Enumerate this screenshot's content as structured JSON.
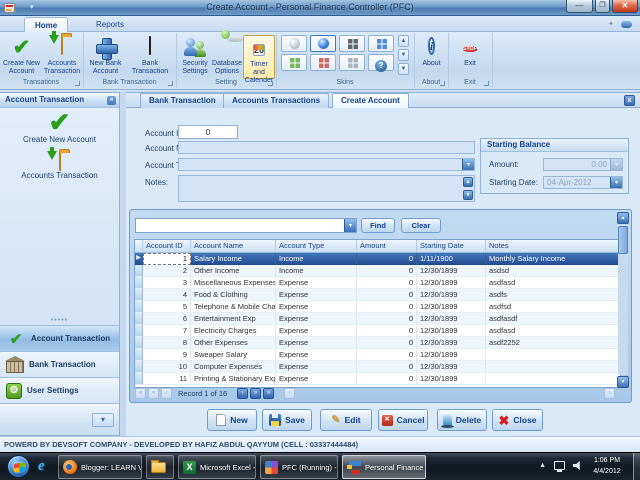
{
  "window": {
    "title": "Create Account - Personal Finance Controller (PFC)"
  },
  "colors": {
    "accent": "#15428b",
    "selection_blue": "#2b5da8",
    "titlebar_blue": "#5585bd",
    "ribbon_bg": "#d5e5f5",
    "taskbar_black": "#12161c",
    "success_green": "#2ca01c",
    "stop_red": "#d22b1f"
  },
  "ribbon": {
    "tabs": [
      {
        "label": "Home"
      },
      {
        "label": "Reports"
      }
    ],
    "active_tab": "Home",
    "groups": [
      {
        "caption": "Transations",
        "buttons": [
          {
            "label": "Create New Account",
            "icon": "green-check-icon"
          },
          {
            "label": "Accounts Transaction",
            "icon": "folder-download-icon"
          }
        ]
      },
      {
        "caption": "Bank Transaction",
        "buttons": [
          {
            "label": "New Bank Account",
            "icon": "blue-plus-icon"
          },
          {
            "label": "Bank Transaction",
            "icon": "ledger-icon"
          }
        ]
      },
      {
        "caption": "Setting",
        "buttons": [
          {
            "label": "Security Settings",
            "icon": "users-icon"
          },
          {
            "label": "Database Options",
            "icon": "database-icon"
          },
          {
            "label": "Timer and Calender",
            "icon": "calendar-icon",
            "selected": true,
            "calendar_day": "26"
          }
        ]
      },
      {
        "caption": "Skins",
        "tiles": [
          "sphere-silver",
          "sphere-blue-selected",
          "squares-dark",
          "squares-blue",
          "squares-green",
          "squares-red",
          "squares-gray",
          "help"
        ]
      },
      {
        "caption": "About",
        "buttons": [
          {
            "label": "About",
            "icon": "info-icon"
          }
        ]
      },
      {
        "caption": "Exit",
        "buttons": [
          {
            "label": "Exit",
            "icon": "stop-icon"
          }
        ]
      }
    ]
  },
  "sidebar": {
    "header": "Account Transaction",
    "shortcuts": [
      {
        "label": "Create New Account",
        "icon": "green-check-icon"
      },
      {
        "label": "Accounts Transaction",
        "icon": "folder-download-icon"
      }
    ],
    "nav_items": [
      {
        "label": "Account Transaction",
        "icon": "check-icon",
        "selected": true
      },
      {
        "label": "Bank Transaction",
        "icon": "bank-icon",
        "selected": false
      },
      {
        "label": "User Settings",
        "icon": "settings-icon",
        "selected": false
      }
    ]
  },
  "document_tabs": [
    {
      "label": "Bank Transaction",
      "active": false
    },
    {
      "label": "Accounts Transactions",
      "active": false
    },
    {
      "label": "Create Account",
      "active": true
    }
  ],
  "form": {
    "account_id_label": "Account ID:",
    "account_id_value": "0",
    "account_name_label": "Account Name:",
    "account_name_value": "",
    "account_type_label": "Account Type:",
    "account_type_value": "",
    "notes_label": "Notes:",
    "notes_value": "",
    "starting_balance": {
      "caption": "Starting Balance",
      "amount_label": "Amount:",
      "amount_value": "0.00",
      "date_label": "Starting Date:",
      "date_value": "04-Apr-2012"
    }
  },
  "finder": {
    "query": "",
    "find_label": "Find",
    "clear_label": "Clear"
  },
  "grid": {
    "columns": [
      "Account ID",
      "Account Name",
      "Account Type",
      "Amount",
      "Starting Date",
      "Notes"
    ],
    "rows": [
      [
        "1",
        "Salary Income",
        "Income",
        "0",
        "1/11/1900",
        "Monthly Salary Income"
      ],
      [
        "2",
        "Other Income",
        "Income",
        "0",
        "12/30/1899",
        "asdsd"
      ],
      [
        "3",
        "Miscellaneous Expenses",
        "Expense",
        "0",
        "12/30/1899",
        "asdfasd"
      ],
      [
        "4",
        "Food & Clothing",
        "Expense",
        "0",
        "12/30/1899",
        "asdfs"
      ],
      [
        "5",
        "Telephone & Mobile Cha...",
        "Expense",
        "0",
        "12/30/1899",
        "asdfsd"
      ],
      [
        "6",
        "Entertainment Exp",
        "Expense",
        "0",
        "12/30/1899",
        "asdfasdf"
      ],
      [
        "7",
        "Electricity Charges",
        "Expense",
        "0",
        "12/30/1899",
        "asdfasd"
      ],
      [
        "8",
        "Other Expenses",
        "Expense",
        "0",
        "12/30/1899",
        "asdf2252"
      ],
      [
        "9",
        "Sweaper Salary",
        "Expense",
        "0",
        "12/30/1899",
        ""
      ],
      [
        "10",
        "Computer Expenses",
        "Expense",
        "0",
        "12/30/1899",
        ""
      ],
      [
        "11",
        "Printing & Stationary Exp",
        "Expense",
        "0",
        "12/30/1899",
        ""
      ]
    ],
    "selected_row_index": 0,
    "record_status": "Record 1 of 16"
  },
  "action_buttons": [
    {
      "label": "New",
      "icon": "new-page-icon"
    },
    {
      "label": "Save",
      "icon": "floppy-icon"
    },
    {
      "label": "Edit",
      "icon": "pencil-icon"
    },
    {
      "label": "Cancel",
      "icon": "cancel-icon"
    },
    {
      "label": "Delete",
      "icon": "delete-icon"
    },
    {
      "label": "Close",
      "icon": "close-red-icon"
    }
  ],
  "status_bar": {
    "text": "POWERD BY DEVSOFT COMPANY - DEVELOPED BY HAFIZ ABDUL QAYYUM  (CELL : 03337444484)"
  },
  "taskbar": {
    "buttons": [
      {
        "label": "Blogger: LEARN V...",
        "icon": "firefox-icon",
        "active": false
      },
      {
        "label": "",
        "icon": "explorer-folder-icon",
        "active": false
      },
      {
        "label": "Microsoft Excel - ...",
        "icon": "excel-icon",
        "active": false
      },
      {
        "label": "PFC (Running) - ...",
        "icon": "pfc-icon",
        "active": false
      },
      {
        "label": "Personal Finance ...",
        "icon": "pf-logo-icon",
        "active": true
      }
    ],
    "clock_time": "1:06 PM",
    "clock_date": "4/4/2012"
  }
}
